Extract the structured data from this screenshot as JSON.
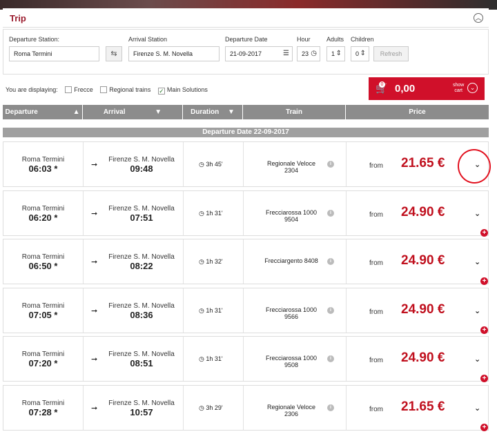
{
  "section": {
    "title": "Trip",
    "collapse_icon": "chevron-up-icon"
  },
  "form": {
    "departure_label": "Departure Station:",
    "departure_value": "Roma Termini",
    "arrival_label": "Arrival Station",
    "arrival_value": "Firenze S. M. Novella",
    "date_label": "Departure Date",
    "date_value": "21-09-2017",
    "hour_label": "Hour",
    "hour_value": "23",
    "adults_label": "Adults",
    "adults_value": "1",
    "children_label": "Children",
    "children_value": "0",
    "refresh_label": "Refresh"
  },
  "filters": {
    "label": "You are displaying:",
    "options": [
      {
        "label": "Frecce",
        "checked": false
      },
      {
        "label": "Regional trains",
        "checked": false
      },
      {
        "label": "Main Solutions",
        "checked": true
      }
    ]
  },
  "cart": {
    "count": "0",
    "amount": "0,00",
    "show_label_1": "show",
    "show_label_2": "cart"
  },
  "columns": [
    "Departure",
    "Arrival",
    "Duration",
    "Train",
    "Price"
  ],
  "date_bar": "Departure Date 22-09-2017",
  "price_prefix": "from",
  "rows": [
    {
      "from": "Roma Termini",
      "dep": "06:03 *",
      "to": "Firenze S. M. Novella",
      "arr": "09:48",
      "duration": "3h 45'",
      "train1": "Regionale Veloce",
      "train2": "2304",
      "price": "21.65 €"
    },
    {
      "from": "Roma Termini",
      "dep": "06:20 *",
      "to": "Firenze S. M. Novella",
      "arr": "07:51",
      "duration": "1h 31'",
      "train1": "Frecciarossa 1000",
      "train2": "9504",
      "price": "24.90 €"
    },
    {
      "from": "Roma Termini",
      "dep": "06:50 *",
      "to": "Firenze S. M. Novella",
      "arr": "08:22",
      "duration": "1h 32'",
      "train1": "Frecciargento 8408",
      "train2": "",
      "price": "24.90 €"
    },
    {
      "from": "Roma Termini",
      "dep": "07:05 *",
      "to": "Firenze S. M. Novella",
      "arr": "08:36",
      "duration": "1h 31'",
      "train1": "Frecciarossa 1000",
      "train2": "9566",
      "price": "24.90 €"
    },
    {
      "from": "Roma Termini",
      "dep": "07:20 *",
      "to": "Firenze S. M. Novella",
      "arr": "08:51",
      "duration": "1h 31'",
      "train1": "Frecciarossa 1000",
      "train2": "9508",
      "price": "24.90 €"
    },
    {
      "from": "Roma Termini",
      "dep": "07:28 *",
      "to": "Firenze S. M. Novella",
      "arr": "10:57",
      "duration": "3h 29'",
      "train1": "Regionale Veloce",
      "train2": "2306",
      "price": "21.65 €"
    }
  ],
  "colors": {
    "brand_red": "#d0102a",
    "price_red": "#c0101e",
    "header_gray": "#8c8c8c"
  }
}
